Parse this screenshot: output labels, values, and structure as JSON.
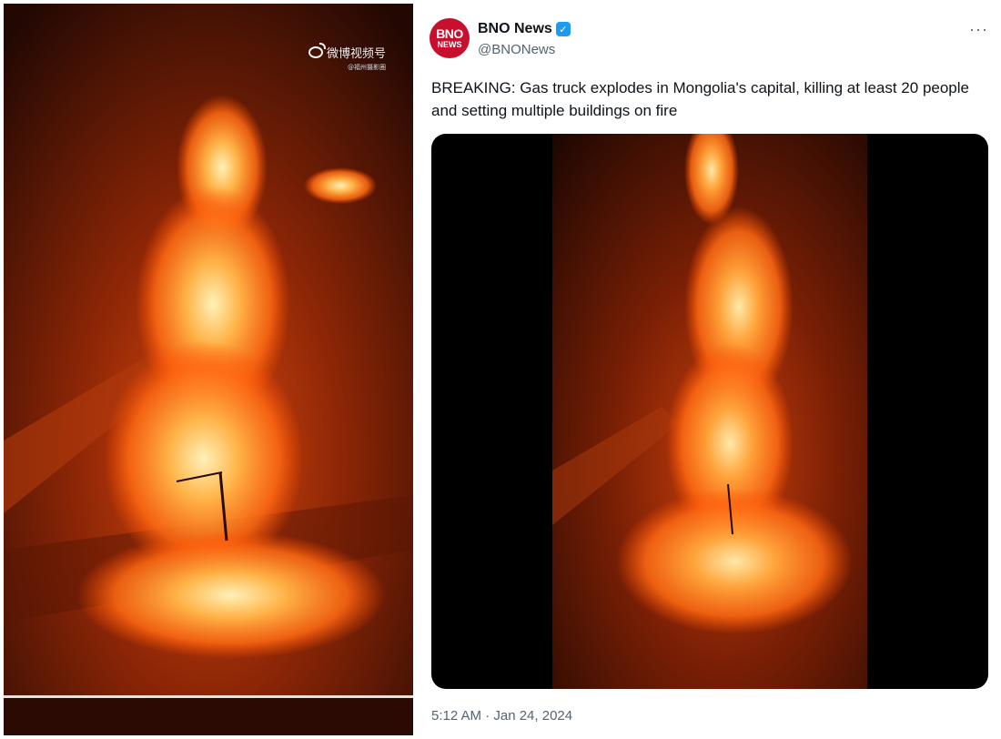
{
  "left_video": {
    "watermark_title": "微博视频号",
    "watermark_sub": "@福州摄影圈",
    "watermark_icon": "weibo-logo-icon"
  },
  "tweet": {
    "avatar": {
      "line1": "BNO",
      "line2": "NEWS",
      "color": "#c8102e"
    },
    "display_name": "BNO News",
    "verified_icon": "verified-badge-icon",
    "handle": "@BNONews",
    "more_icon": "more-options-icon",
    "more_label": "···",
    "text": "BREAKING: Gas truck explodes in Mongolia's capital, killing at least 20 people and setting multiple buildings on fire",
    "timestamp": "5:12 AM · Jan 24, 2024"
  },
  "colors": {
    "accent_blue": "#1d9bf0",
    "text_primary": "#0f1419",
    "text_secondary": "#536471",
    "fire_bright": "#ffb347",
    "fire_mid": "#ff6a13",
    "fire_dark": "#7a1f05"
  }
}
